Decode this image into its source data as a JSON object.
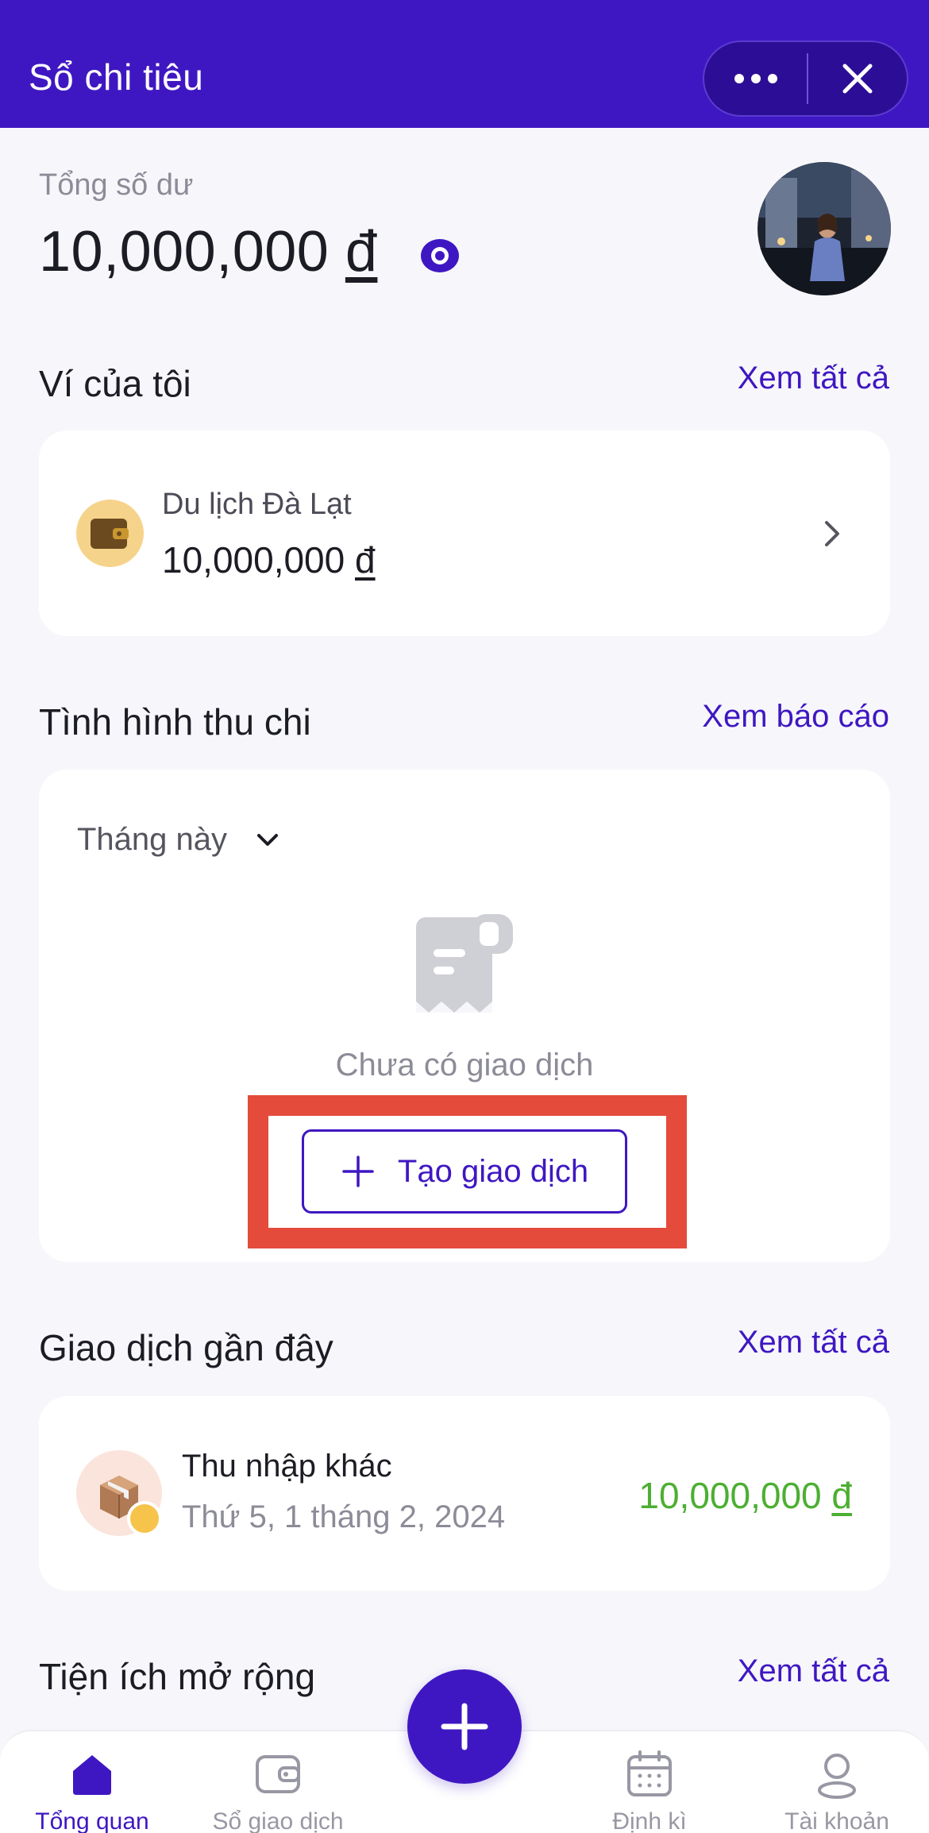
{
  "header": {
    "title": "Sổ chi tiêu",
    "more_icon": "more-dots-icon",
    "close_icon": "close-icon"
  },
  "balance": {
    "label": "Tổng số dư",
    "amount": "10,000,000",
    "currency": "đ",
    "visibility_icon": "eye-icon"
  },
  "wallets": {
    "title": "Ví của tôi",
    "view_all": "Xem tất cả",
    "items": [
      {
        "name": "Du lịch Đà Lạt",
        "amount": "10,000,000",
        "currency": "đ"
      }
    ]
  },
  "cashflow": {
    "title": "Tình hình thu chi",
    "report_link": "Xem báo cáo",
    "period": "Tháng này",
    "empty_text": "Chưa có giao dịch",
    "create_button": "Tạo giao dịch"
  },
  "recent": {
    "title": "Giao dịch gần đây",
    "view_all": "Xem tất cả",
    "items": [
      {
        "name": "Thu nhập khác",
        "date": "Thứ 5, 1 tháng 2, 2024",
        "amount": "10,000,000",
        "currency": "đ"
      }
    ]
  },
  "extensions": {
    "title": "Tiện ích mở rộng",
    "view_all": "Xem tất cả"
  },
  "bottom_nav": {
    "items": [
      {
        "label": "Tổng quan",
        "icon": "home-icon",
        "active": true
      },
      {
        "label": "Sổ giao dịch",
        "icon": "wallet-icon",
        "active": false
      },
      {
        "label": "Định kì",
        "icon": "calendar-icon",
        "active": false
      },
      {
        "label": "Tài khoản",
        "icon": "user-icon",
        "active": false
      }
    ],
    "fab_icon": "plus-icon"
  },
  "colors": {
    "primary": "#3f17c2",
    "income": "#4caf32",
    "highlight": "#e44b3b",
    "background": "#f7f7fb"
  }
}
